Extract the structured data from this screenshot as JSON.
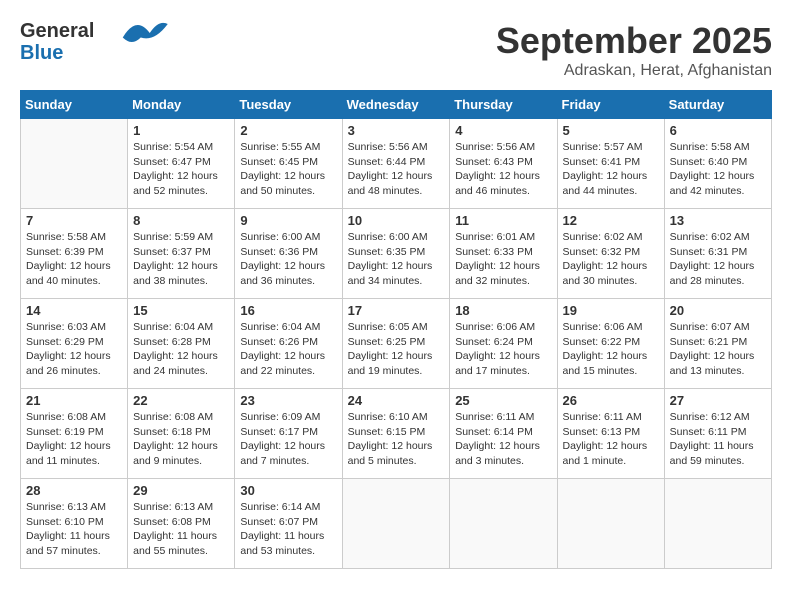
{
  "header": {
    "logo_line1": "General",
    "logo_line2": "Blue",
    "month": "September 2025",
    "location": "Adraskan, Herat, Afghanistan"
  },
  "weekdays": [
    "Sunday",
    "Monday",
    "Tuesday",
    "Wednesday",
    "Thursday",
    "Friday",
    "Saturday"
  ],
  "weeks": [
    [
      {
        "day": "",
        "info": ""
      },
      {
        "day": "1",
        "info": "Sunrise: 5:54 AM\nSunset: 6:47 PM\nDaylight: 12 hours\nand 52 minutes."
      },
      {
        "day": "2",
        "info": "Sunrise: 5:55 AM\nSunset: 6:45 PM\nDaylight: 12 hours\nand 50 minutes."
      },
      {
        "day": "3",
        "info": "Sunrise: 5:56 AM\nSunset: 6:44 PM\nDaylight: 12 hours\nand 48 minutes."
      },
      {
        "day": "4",
        "info": "Sunrise: 5:56 AM\nSunset: 6:43 PM\nDaylight: 12 hours\nand 46 minutes."
      },
      {
        "day": "5",
        "info": "Sunrise: 5:57 AM\nSunset: 6:41 PM\nDaylight: 12 hours\nand 44 minutes."
      },
      {
        "day": "6",
        "info": "Sunrise: 5:58 AM\nSunset: 6:40 PM\nDaylight: 12 hours\nand 42 minutes."
      }
    ],
    [
      {
        "day": "7",
        "info": "Sunrise: 5:58 AM\nSunset: 6:39 PM\nDaylight: 12 hours\nand 40 minutes."
      },
      {
        "day": "8",
        "info": "Sunrise: 5:59 AM\nSunset: 6:37 PM\nDaylight: 12 hours\nand 38 minutes."
      },
      {
        "day": "9",
        "info": "Sunrise: 6:00 AM\nSunset: 6:36 PM\nDaylight: 12 hours\nand 36 minutes."
      },
      {
        "day": "10",
        "info": "Sunrise: 6:00 AM\nSunset: 6:35 PM\nDaylight: 12 hours\nand 34 minutes."
      },
      {
        "day": "11",
        "info": "Sunrise: 6:01 AM\nSunset: 6:33 PM\nDaylight: 12 hours\nand 32 minutes."
      },
      {
        "day": "12",
        "info": "Sunrise: 6:02 AM\nSunset: 6:32 PM\nDaylight: 12 hours\nand 30 minutes."
      },
      {
        "day": "13",
        "info": "Sunrise: 6:02 AM\nSunset: 6:31 PM\nDaylight: 12 hours\nand 28 minutes."
      }
    ],
    [
      {
        "day": "14",
        "info": "Sunrise: 6:03 AM\nSunset: 6:29 PM\nDaylight: 12 hours\nand 26 minutes."
      },
      {
        "day": "15",
        "info": "Sunrise: 6:04 AM\nSunset: 6:28 PM\nDaylight: 12 hours\nand 24 minutes."
      },
      {
        "day": "16",
        "info": "Sunrise: 6:04 AM\nSunset: 6:26 PM\nDaylight: 12 hours\nand 22 minutes."
      },
      {
        "day": "17",
        "info": "Sunrise: 6:05 AM\nSunset: 6:25 PM\nDaylight: 12 hours\nand 19 minutes."
      },
      {
        "day": "18",
        "info": "Sunrise: 6:06 AM\nSunset: 6:24 PM\nDaylight: 12 hours\nand 17 minutes."
      },
      {
        "day": "19",
        "info": "Sunrise: 6:06 AM\nSunset: 6:22 PM\nDaylight: 12 hours\nand 15 minutes."
      },
      {
        "day": "20",
        "info": "Sunrise: 6:07 AM\nSunset: 6:21 PM\nDaylight: 12 hours\nand 13 minutes."
      }
    ],
    [
      {
        "day": "21",
        "info": "Sunrise: 6:08 AM\nSunset: 6:19 PM\nDaylight: 12 hours\nand 11 minutes."
      },
      {
        "day": "22",
        "info": "Sunrise: 6:08 AM\nSunset: 6:18 PM\nDaylight: 12 hours\nand 9 minutes."
      },
      {
        "day": "23",
        "info": "Sunrise: 6:09 AM\nSunset: 6:17 PM\nDaylight: 12 hours\nand 7 minutes."
      },
      {
        "day": "24",
        "info": "Sunrise: 6:10 AM\nSunset: 6:15 PM\nDaylight: 12 hours\nand 5 minutes."
      },
      {
        "day": "25",
        "info": "Sunrise: 6:11 AM\nSunset: 6:14 PM\nDaylight: 12 hours\nand 3 minutes."
      },
      {
        "day": "26",
        "info": "Sunrise: 6:11 AM\nSunset: 6:13 PM\nDaylight: 12 hours\nand 1 minute."
      },
      {
        "day": "27",
        "info": "Sunrise: 6:12 AM\nSunset: 6:11 PM\nDaylight: 11 hours\nand 59 minutes."
      }
    ],
    [
      {
        "day": "28",
        "info": "Sunrise: 6:13 AM\nSunset: 6:10 PM\nDaylight: 11 hours\nand 57 minutes."
      },
      {
        "day": "29",
        "info": "Sunrise: 6:13 AM\nSunset: 6:08 PM\nDaylight: 11 hours\nand 55 minutes."
      },
      {
        "day": "30",
        "info": "Sunrise: 6:14 AM\nSunset: 6:07 PM\nDaylight: 11 hours\nand 53 minutes."
      },
      {
        "day": "",
        "info": ""
      },
      {
        "day": "",
        "info": ""
      },
      {
        "day": "",
        "info": ""
      },
      {
        "day": "",
        "info": ""
      }
    ]
  ]
}
